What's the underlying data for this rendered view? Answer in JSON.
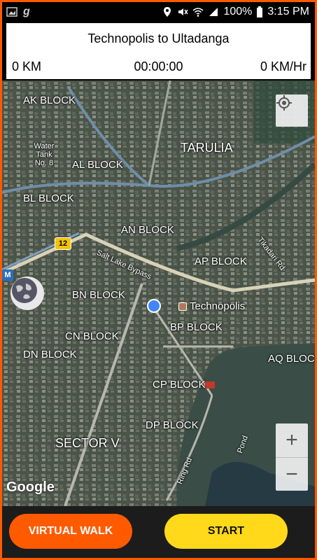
{
  "status_bar": {
    "battery": "100%",
    "time": "3:15 PM",
    "icons": [
      "gallery-icon",
      "g-app-icon",
      "location-icon",
      "mute-icon",
      "wifi-icon",
      "signal-icon",
      "battery-icon"
    ]
  },
  "route": {
    "title": "Technopolis to Ultadanga",
    "distance": "0 KM",
    "elapsed": "00:00:00",
    "speed": "0 KM/Hr"
  },
  "map": {
    "labels": {
      "ak_block": "AK BLOCK",
      "al_block": "AL BLOCK",
      "bl_block": "BL BLOCK",
      "an_block": "AN BLOCK",
      "ap_block": "AP BLOCK",
      "bn_block": "BN BLOCK",
      "bp_block": "BP BLOCK",
      "cn_block": "CN BLOCK",
      "dn_block": "DN BLOCK",
      "aq_block": "AQ BLOC",
      "cp_block": "CP BLOCK",
      "dp_block": "DP BLOCK",
      "sector_v": "SECTOR V",
      "tarulia": "TARULIA",
      "water_tank": "Water Tank No. 8",
      "technopolis": "Technopolis",
      "salt_lake_bypass": "Salt Lake Bypass",
      "tikadari_rd": "Tikadari Rd",
      "ring_rd": "Ring Rd",
      "pond": "Pond"
    },
    "route_shield": "12",
    "metro_badge": "M",
    "attribution": "Google",
    "zoom_in": "+",
    "zoom_out": "−"
  },
  "actions": {
    "virtual_walk": "VIRTUAL WALK",
    "start": "START"
  },
  "colors": {
    "accent_orange": "#ff5a00",
    "start_yellow": "#ffd91a",
    "location_blue": "#4285f4"
  }
}
